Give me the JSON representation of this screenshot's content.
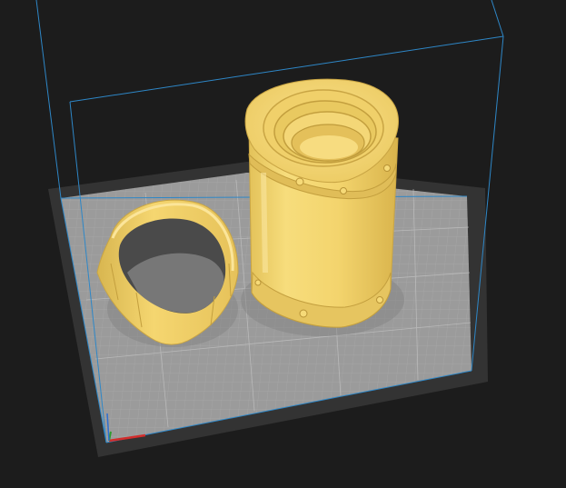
{
  "viewport": {
    "background_color": "#1c1c1c"
  },
  "build_plate": {
    "frame_color": "#333333",
    "surface_color": "#9b9b9b",
    "grid_color": "#b6b6b6"
  },
  "build_volume": {
    "outline_color": "#2e87c7"
  },
  "axes": {
    "x_axis_color": "#d12d2d",
    "y_axis_color": "#2d9e2d",
    "z_axis_color": "#2e6fd1"
  },
  "models": [
    {
      "name": "ring-part",
      "color": "#f5d76e",
      "selected": false
    },
    {
      "name": "cylinder-part",
      "color": "#f5d76e",
      "selected": false
    }
  ]
}
